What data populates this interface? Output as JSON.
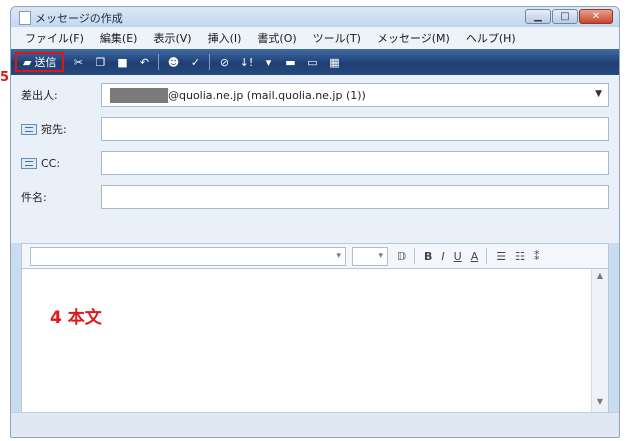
{
  "window": {
    "title": "メッセージの作成"
  },
  "menu": [
    "ファイル(F)",
    "編集(E)",
    "表示(V)",
    "挿入(I)",
    "書式(O)",
    "ツール(T)",
    "メッセージ(M)",
    "ヘルプ(H)"
  ],
  "toolbar": {
    "send_label": "送信",
    "highlight_color": "#e31414"
  },
  "header": {
    "from_label": "差出人:",
    "from_value": "@quolia.ne.jp   (mail.quolia.ne.jp (1))",
    "to_label": "宛先:",
    "cc_label": "CC:",
    "subject_label": "件名:"
  },
  "body": {
    "annotation": "4 本文"
  },
  "edge_labels": {
    "send_num": "5"
  },
  "colors": {
    "annotation": "#e01818"
  }
}
